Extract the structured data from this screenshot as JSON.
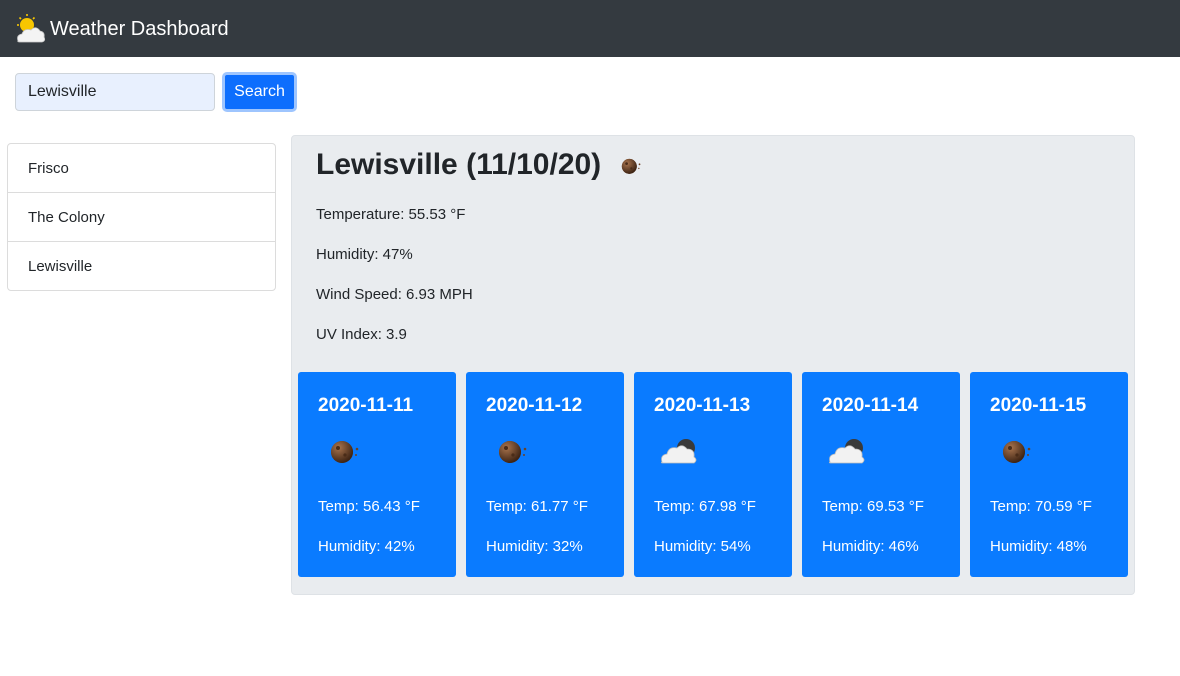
{
  "navbar": {
    "title": "Weather Dashboard",
    "icon": "sun-behind-cloud-icon"
  },
  "search": {
    "value": "Lewisville",
    "button_label": "Search"
  },
  "history": [
    {
      "label": "Frisco"
    },
    {
      "label": "The Colony"
    },
    {
      "label": "Lewisville"
    }
  ],
  "current": {
    "title": "Lewisville (11/10/20)",
    "icon": "clear-night-moon-icon",
    "temperature": "Temperature: 55.53 °F",
    "humidity": "Humidity: 47%",
    "wind": "Wind Speed: 6.93 MPH",
    "uv": "UV Index: 3.9"
  },
  "forecast": [
    {
      "date": "2020-11-11",
      "icon": "clear-night-moon-icon",
      "temp": "Temp: 56.43 °F",
      "humidity": "Humidity: 42%"
    },
    {
      "date": "2020-11-12",
      "icon": "clear-night-moon-icon",
      "temp": "Temp: 61.77 °F",
      "humidity": "Humidity: 32%"
    },
    {
      "date": "2020-11-13",
      "icon": "cloudy-night-icon",
      "temp": "Temp: 67.98 °F",
      "humidity": "Humidity: 54%"
    },
    {
      "date": "2020-11-14",
      "icon": "cloudy-night-icon",
      "temp": "Temp: 69.53 °F",
      "humidity": "Humidity: 46%"
    },
    {
      "date": "2020-11-15",
      "icon": "clear-night-moon-icon",
      "temp": "Temp: 70.59 °F",
      "humidity": "Humidity: 48%"
    }
  ],
  "colors": {
    "navbar": "#343a40",
    "primary": "#0d6efd",
    "forecast_card": "#0a7bff",
    "panel": "#e9ecef"
  }
}
